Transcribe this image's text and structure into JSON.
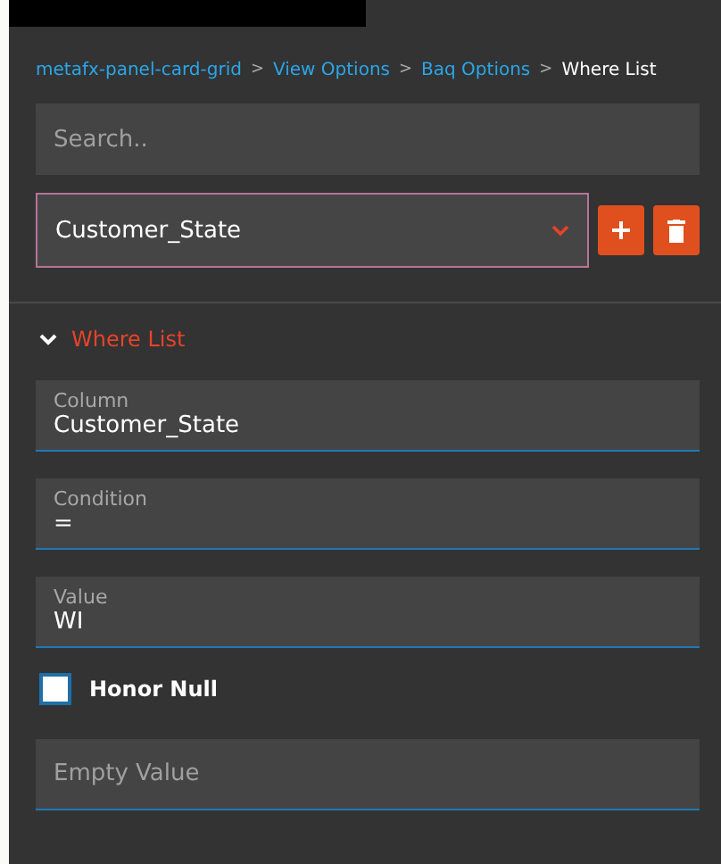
{
  "breadcrumb": [
    {
      "label": "metafx-panel-card-grid",
      "current": false
    },
    {
      "label": "View Options",
      "current": false
    },
    {
      "label": "Baq Options",
      "current": false
    },
    {
      "label": "Where List",
      "current": true
    }
  ],
  "breadcrumb_separator": ">",
  "search": {
    "placeholder": "Search.."
  },
  "where_select": {
    "value": "Customer_State"
  },
  "section": {
    "title": "Where List",
    "expanded": true
  },
  "fields": [
    {
      "kind": "labeled",
      "label": "Column",
      "value": "Customer_State"
    },
    {
      "kind": "labeled",
      "label": "Condition",
      "value": "="
    },
    {
      "kind": "labeled",
      "label": "Value",
      "value": "WI"
    },
    {
      "kind": "checkbox",
      "label": "Honor Null",
      "checked": false
    },
    {
      "kind": "plain",
      "placeholder": "Empty Value"
    }
  ]
}
